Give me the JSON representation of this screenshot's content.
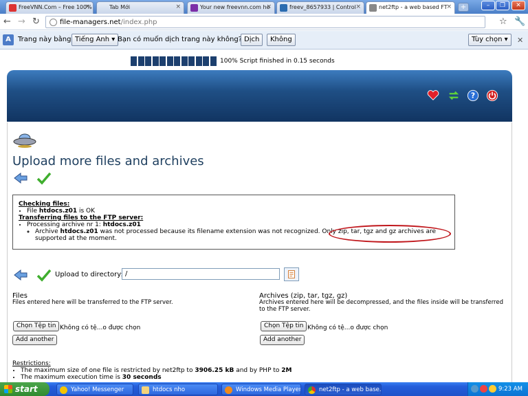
{
  "browser": {
    "tabs": [
      {
        "label": "FreeVNN.Com – Free 100%",
        "favicon_color": "#d33"
      },
      {
        "label": "Tab Mới",
        "favicon_color": ""
      },
      {
        "label": "Your new freevnn.com ho",
        "favicon_color": "#7b2fa8"
      },
      {
        "label": "freev_8657933 | Control",
        "favicon_color": "#2b6cb0"
      },
      {
        "label": "net2ftp - a web based FT",
        "favicon_color": "#888"
      }
    ],
    "url_host": "file-managers.net",
    "url_path": "/index.php"
  },
  "translate_bar": {
    "prefix": "Trang này bằng",
    "language": "Tiếng Anh ▾",
    "question": "Bạn có muốn dịch trang này không?",
    "translate_button": "Dịch",
    "no_button": "Không",
    "options_button": "Tùy chọn ▾"
  },
  "page": {
    "progress_text": "100% Script finished in 0.15 seconds",
    "progress_percent": 100,
    "title": "Upload more files and archives",
    "log": {
      "checking_heading": "Checking files:",
      "file_prefix": "File ",
      "file_name": "htdocs.z01",
      "file_suffix": " is OK",
      "transfer_heading": "Transferring files to the FTP server:",
      "processing_prefix": "Processing archive nr 1: ",
      "processing_name": "htdocs.z01",
      "archive_prefix": "Archive ",
      "archive_name": "htdocs.z01",
      "archive_msg": " was not processed because its filename extension was not recognized. Only zip, tar, tgz and gz archives are supported at the moment."
    },
    "upload_label": "Upload to directory:",
    "directory_value": "/",
    "files": {
      "title": "Files",
      "desc": "Files entered here will be transferred to the FTP server.",
      "choose_button": "Chọn Tệp tin",
      "status": "Không có tệ...o được chọn",
      "add_button": "Add another"
    },
    "archives": {
      "title": "Archives (zip, tar, tgz, gz)",
      "desc": "Archives entered here will be decompressed, and the files inside will be transferred to the FTP server.",
      "choose_button": "Chọn Tệp tin",
      "status": "Không có tệ...o được chọn",
      "add_button": "Add another"
    },
    "restrictions": {
      "heading": "Restrictions:",
      "line1_prefix": "The maximum size of one file is restricted by net2ftp to ",
      "line1_value": "3906.25 kB",
      "line1_mid": " and by PHP to ",
      "line1_value2": "2M",
      "line2_prefix": "The maximum execution time is ",
      "line2_value": "30 seconds"
    },
    "accent_color": "#1e3f5f",
    "highlight_color": "#c0171c"
  },
  "taskbar": {
    "start": "start",
    "tasks": [
      {
        "label": "Yahoo! Messenger"
      },
      {
        "label": "htdocs nho"
      },
      {
        "label": "Windows Media Player"
      },
      {
        "label": "net2ftp - a web base..."
      }
    ],
    "clock": "9:23 AM"
  }
}
